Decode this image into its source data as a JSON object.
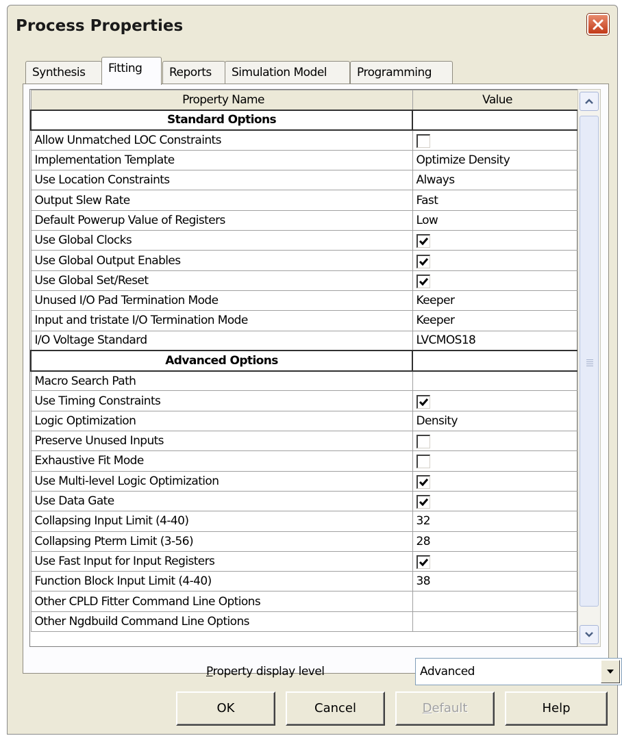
{
  "window": {
    "title": "Process Properties"
  },
  "tabs": [
    {
      "label": "Synthesis",
      "active": false
    },
    {
      "label": "Fitting",
      "active": true
    },
    {
      "label": "Reports",
      "active": false
    },
    {
      "label": "Simulation Model",
      "active": false
    },
    {
      "label": "Programming",
      "active": false
    }
  ],
  "table": {
    "headers": {
      "name": "Property Name",
      "value": "Value"
    },
    "sections": [
      {
        "title": "Standard Options",
        "rows": [
          {
            "name": "Allow Unmatched LOC Constraints",
            "type": "checkbox",
            "checked": false
          },
          {
            "name": "Implementation Template",
            "type": "text",
            "value": "Optimize Density"
          },
          {
            "name": "Use Location Constraints",
            "type": "text",
            "value": "Always"
          },
          {
            "name": "Output Slew Rate",
            "type": "text",
            "value": "Fast"
          },
          {
            "name": "Default Powerup Value of Registers",
            "type": "text",
            "value": "Low"
          },
          {
            "name": "Use Global Clocks",
            "type": "checkbox",
            "checked": true
          },
          {
            "name": "Use Global Output Enables",
            "type": "checkbox",
            "checked": true
          },
          {
            "name": "Use Global Set/Reset",
            "type": "checkbox",
            "checked": true
          },
          {
            "name": "Unused I/O Pad Termination Mode",
            "type": "text",
            "value": "Keeper"
          },
          {
            "name": "Input and tristate I/O Termination Mode",
            "type": "text",
            "value": "Keeper"
          },
          {
            "name": "I/O Voltage Standard",
            "type": "text",
            "value": "LVCMOS18"
          }
        ]
      },
      {
        "title": "Advanced Options",
        "rows": [
          {
            "name": "Macro Search Path",
            "type": "text",
            "value": ""
          },
          {
            "name": "Use Timing Constraints",
            "type": "checkbox",
            "checked": true
          },
          {
            "name": "Logic Optimization",
            "type": "text",
            "value": "Density"
          },
          {
            "name": "Preserve Unused Inputs",
            "type": "checkbox",
            "checked": false
          },
          {
            "name": "Exhaustive Fit Mode",
            "type": "checkbox",
            "checked": false
          },
          {
            "name": "Use Multi-level Logic Optimization",
            "type": "checkbox",
            "checked": true
          },
          {
            "name": "Use Data Gate",
            "type": "checkbox",
            "checked": true
          },
          {
            "name": "Collapsing Input Limit (4-40)",
            "type": "text",
            "value": "32"
          },
          {
            "name": "Collapsing Pterm Limit (3-56)",
            "type": "text",
            "value": "28"
          },
          {
            "name": "Use Fast Input for Input Registers",
            "type": "checkbox",
            "checked": true
          },
          {
            "name": "Function Block Input Limit (4-40)",
            "type": "text",
            "value": "38"
          },
          {
            "name": "Other CPLD Fitter Command Line Options",
            "type": "text",
            "value": ""
          },
          {
            "name": "Other Ngdbuild Command Line Options",
            "type": "text",
            "value": ""
          }
        ]
      }
    ]
  },
  "display_level": {
    "label": "Property display level",
    "selected": "Advanced"
  },
  "buttons": {
    "ok": "OK",
    "cancel": "Cancel",
    "default": "Default",
    "help": "Help"
  },
  "icons": {
    "close": "close-icon",
    "scroll_up": "chevron-up-icon",
    "scroll_down": "chevron-down-icon",
    "dropdown": "dropdown-arrow-icon",
    "check": "checkmark-icon"
  },
  "colors": {
    "dialog_bg": "#ece9d8",
    "close_button": "#c23a18"
  }
}
